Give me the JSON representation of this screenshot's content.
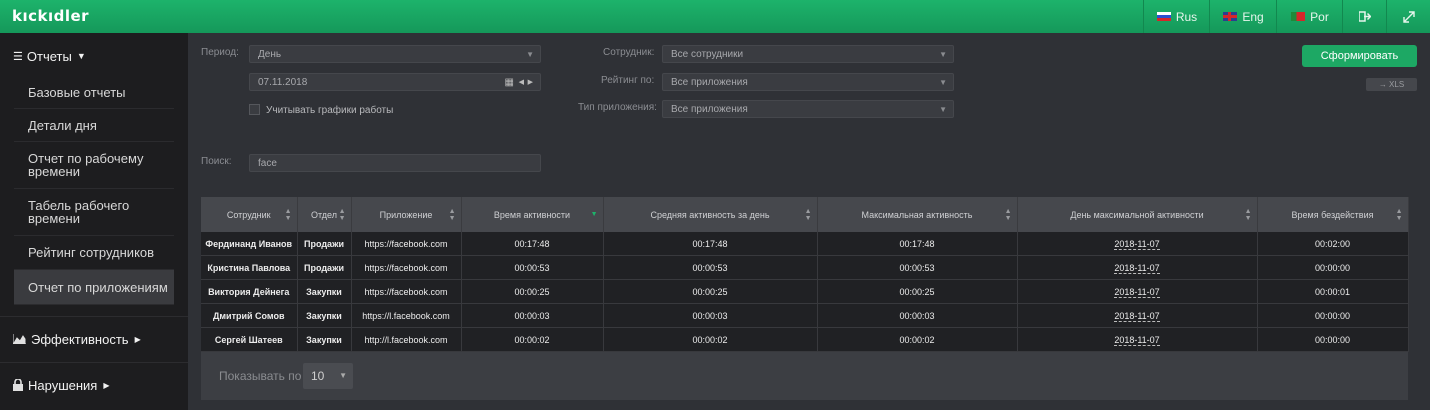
{
  "app": {
    "logo": "kıckıdler"
  },
  "topbar": {
    "lang_ru": "Rus",
    "lang_en": "Eng",
    "lang_pt": "Por"
  },
  "sidebar": {
    "reports_label": "Отчеты",
    "items": [
      {
        "label": "Базовые отчеты"
      },
      {
        "label": "Детали дня"
      },
      {
        "label": "Отчет по рабочему времени"
      },
      {
        "label": "Табель рабочего времени"
      },
      {
        "label": "Рейтинг сотрудников"
      },
      {
        "label": "Отчет по приложениям"
      }
    ],
    "efficiency_label": "Эффективность",
    "violations_label": "Нарушения"
  },
  "filters": {
    "period_label": "Период:",
    "period_value": "День",
    "date_value": "07.11.2018",
    "schedule_label": "Учитывать графики работы",
    "employee_label": "Сотрудник:",
    "employee_value": "Все сотрудники",
    "rating_label": "Рейтинг по:",
    "rating_value": "Все приложения",
    "apptype_label": "Тип приложения:",
    "apptype_value": "Все приложения",
    "search_label": "Поиск:",
    "search_value": "face",
    "submit_label": "Сформировать",
    "xls_label": "→ XLS"
  },
  "table": {
    "headers": [
      "Сотрудник",
      "Отдел",
      "Приложение",
      "Время активности",
      "Средняя активность за день",
      "Максимальная активность",
      "День максимальной активности",
      "Время бездействия"
    ],
    "rows": [
      [
        "Фердинанд Иванов",
        "Продажи",
        "https://facebook.com",
        "00:17:48",
        "00:17:48",
        "00:17:48",
        "2018-11-07",
        "00:02:00"
      ],
      [
        "Кристина Павлова",
        "Продажи",
        "https://facebook.com",
        "00:00:53",
        "00:00:53",
        "00:00:53",
        "2018-11-07",
        "00:00:00"
      ],
      [
        "Виктория Дейнега",
        "Закупки",
        "https://facebook.com",
        "00:00:25",
        "00:00:25",
        "00:00:25",
        "2018-11-07",
        "00:00:01"
      ],
      [
        "Дмитрий Сомов",
        "Закупки",
        "https://l.facebook.com",
        "00:00:03",
        "00:00:03",
        "00:00:03",
        "2018-11-07",
        "00:00:00"
      ],
      [
        "Сергей Шатеев",
        "Закупки",
        "http://l.facebook.com",
        "00:00:02",
        "00:00:02",
        "00:00:02",
        "2018-11-07",
        "00:00:00"
      ]
    ]
  },
  "pagination": {
    "show_label": "Показывать по",
    "page_size": "10"
  },
  "colors": {
    "brand": "#1db36b",
    "sidebar": "#1d1d1f",
    "content": "#2f3136"
  }
}
